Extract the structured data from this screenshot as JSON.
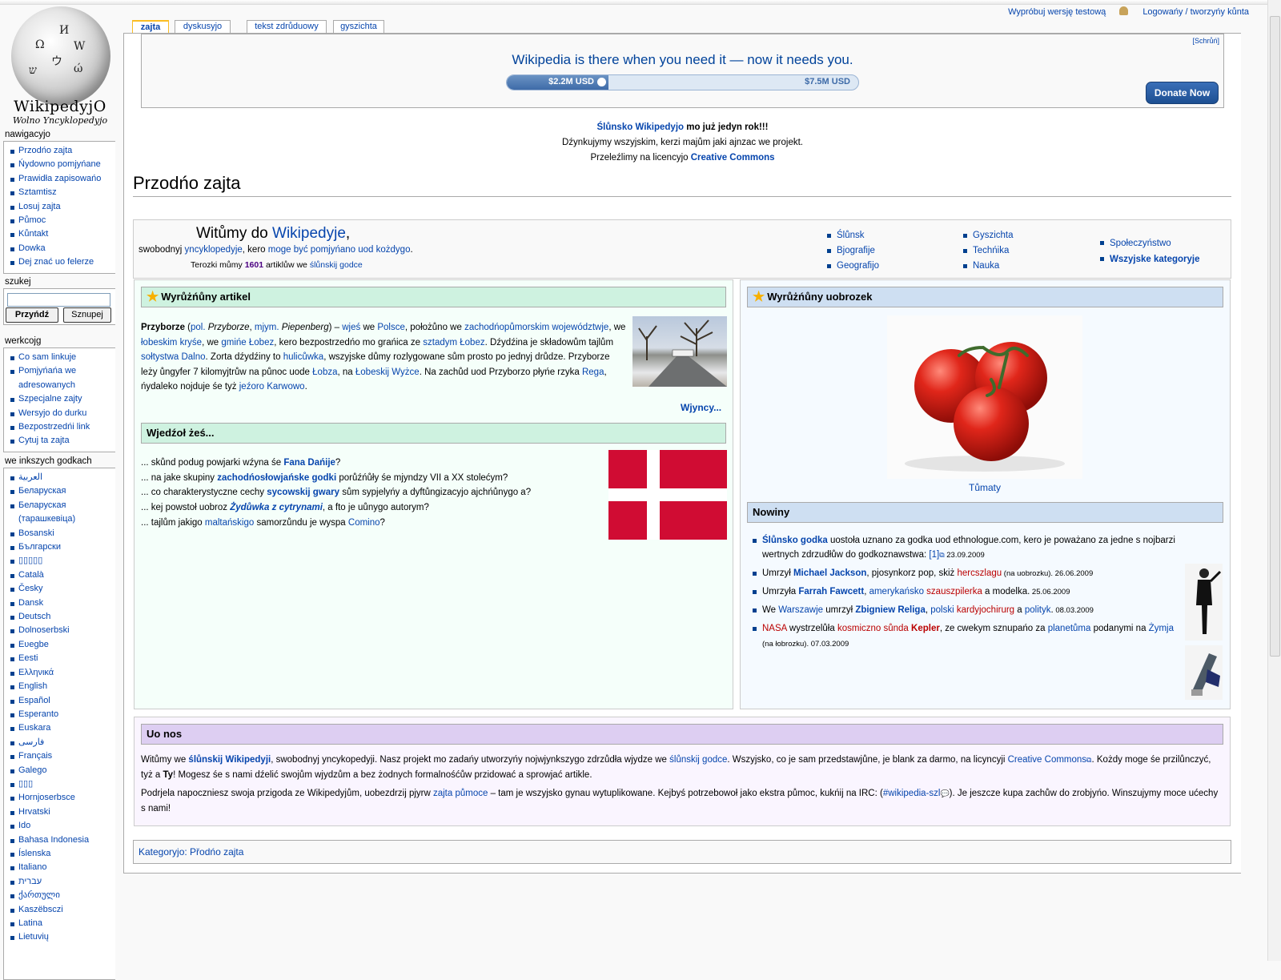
{
  "personal": {
    "beta": "Wypróbuj wersję testową",
    "login": "Logowańy / tworzyńy kůnta"
  },
  "logo": {
    "wordmark": "WikipedyjO",
    "tagline": "Wolno Yncyklopedyjo"
  },
  "tabs": [
    "zajta",
    "dyskusyjo",
    "tekst zdrůduowy",
    "gyszichta"
  ],
  "nav": {
    "title": "nawigacyjo",
    "items": [
      "Przodńo zajta",
      "Ńydowno pomjyńane",
      "Prawidła zapisowańo",
      "Sztamtisz",
      "Losuj zajta",
      "Půmoc",
      "Kůntakt",
      "Dowka",
      "Dej znać uo felerze"
    ]
  },
  "search": {
    "title": "szukej",
    "go": "Przyńdź",
    "find": "Sznupej"
  },
  "tools": {
    "title": "werkcojg",
    "items": [
      "Co sam linkuje",
      "Pomjyńańa we adresowanych",
      "Szpecjalne zajty",
      "Wersyjo do durku",
      "Bezpostrzedńi link",
      "Cytuj ta zajta"
    ]
  },
  "langs": {
    "title": "we inkszych godkach",
    "items": [
      "العربية",
      "Беларуская",
      "Беларуская (тарашкевіца)",
      "Bosanski",
      "Български",
      "▯▯▯▯▯",
      "Català",
      "Česky",
      "Dansk",
      "Deutsch",
      "Dolnoserbski",
      "Eʋegbe",
      "Eesti",
      "Ελληνικά",
      "English",
      "Español",
      "Esperanto",
      "Euskara",
      "فارسی",
      "Français",
      "Galego",
      "▯▯▯",
      "Hornjoserbsce",
      "Hrvatski",
      "Ido",
      "Bahasa Indonesia",
      "Íslenska",
      "Italiano",
      "עברית",
      "ქართული",
      "Kaszëbsczi",
      "Latina",
      "Lietuvių"
    ]
  },
  "banner": {
    "close": "[Schrůń]",
    "headline": "Wikipedia is there when you need it — now it needs you.",
    "raised": "$2.2M USD",
    "goal": "$7.5M USD",
    "progress": 0.29,
    "donate": "Donate Now"
  },
  "sitenotice": {
    "l1_link": "Ślůnsko Wikipedyjo",
    "l1_rest": " mo już jedyn rok!!!",
    "l2": "Dźynkujymy wszyjskim, kerzi majům jaki ajnzac we projekt.",
    "l3_pre": "Przeleźlimy na licencyjo ",
    "l3_link": "Creative Commons"
  },
  "heading": "Przodńo zajta",
  "welcome": {
    "pre": "Witůmy do ",
    "link": "Wikipedyje",
    "post": ",",
    "l2a": "swobodnyj ",
    "l2b": "yncyklopedyje",
    "l2c": ", kero ",
    "l2d": "moge być pomjyńano uod kożdygo",
    "l3a": "Terozki můmy ",
    "count": "1601",
    "l3b": " artiklůw we ",
    "l3c": "ślůnskij godce",
    "portals1": [
      "Ślůnsk",
      "Bjografije",
      "Geografijo"
    ],
    "portals2": [
      "Gyszichta",
      "Techńika",
      "Nauka"
    ],
    "portals3": [
      "Społeczyństwo",
      "Wszyjske kategoryje"
    ]
  },
  "article": {
    "title": "Wyrůżńůny artikel",
    "more": "Wjyncy...",
    "t": {
      "a": "Przyborze",
      "b": " (",
      "c": "pol.",
      "d": " ",
      "e": "Przyborze",
      "f": ", ",
      "g": "mjym.",
      "h": " ",
      "i": "Piepenberg",
      "j": ") – ",
      "k": "wjeś",
      "l": " we ",
      "m": "Polsce",
      "n": ", położůno we ",
      "o": "zachodńopůmorskim województwje",
      "p": ", we ",
      "q": "łobeskim kryśe",
      "r": ", we ",
      "s": "gmińe Łobez",
      "t": ", kero bezpostrzedńo mo grańica ze ",
      "u": "sztadym Łobez",
      "v": ". Dźydźina je składowům tajlům ",
      "w": "sołtystwa Dalno",
      "x": ". Zorta dźydźiny to ",
      "y": "hulicůwka",
      "z": ", wszyjske důmy rozlygowane sům prosto po jednyj drůdze. Przyborze leży ůngyfer 7 kilomyjtrůw na půnoc uode ",
      "aa": "Łobza",
      "ab": ", na ",
      "ac": "Łobeskij Wyżce",
      "ad": ". Na zachůd uod Przyborzo płyńe rzyka ",
      "ae": "Rega",
      "af": ", ńydaleko nojduje śe tyż ",
      "ag": "jeźoro Karwowo",
      "ah": "."
    }
  },
  "dyk": {
    "title": "Wjedźoł żeś...",
    "r1a": "... skůnd podug powjarki wźyna śe ",
    "r1b": "Fana Dańije",
    "r1c": "?",
    "r2a": "... na jake skupiny ",
    "r2b": "zachodńosłowjańske godki",
    "r2c": " porůźńůły śe mjyndzy VII a XX stolećym?",
    "r3a": "... co charakterystyczne cechy ",
    "r3b": "sycowskij gwary",
    "r3c": " sům sypjelyńy a dyftůngizacyjo ajchńůnygo a?",
    "r4a": "... kej powstoł uobroz ",
    "r4b": "Żydůwka z cytrynami",
    "r4c": ", a fto je uůnygo autorym?",
    "r5a": "... tajlům jakigo ",
    "r5b": "maltańskigo",
    "r5c": " samorzůndu je wyspa ",
    "r5d": "Comino",
    "r5e": "?"
  },
  "picture": {
    "title": "Wyrůżńůny uobrozek",
    "caption": "Tůmaty"
  },
  "news": {
    "title": "Nowiny",
    "n1a": "Ślůnsko godka",
    "n1b": " uostoła uznano za godka uod ethnologue.com, kero je poważano za jedne s nojbarzi wertnych zdrzudłůw do godkoznawstwa: ",
    "n1c": "[1]",
    "n1d": " 23.09.2009",
    "n2a": "Umrzył ",
    "n2b": "Michael Jackson",
    "n2c": ", pjosynkorz pop, skiż ",
    "n2d": "hercszlagu",
    "n2e": " (na uobrozku).",
    "n2f": " 26.06.2009",
    "n3a": "Umrzyła ",
    "n3b": "Farrah Fawcett",
    "n3c": ", ",
    "n3d": "amerykańsko",
    "n3e": " ",
    "n3f": "szauszpilerka",
    "n3g": " a modelka.",
    "n3h": " 25.06.2009",
    "n4a": "We ",
    "n4b": "Warszawje",
    "n4c": " umrzył ",
    "n4d": "Zbigniew Religa",
    "n4e": ", ",
    "n4f": "polski",
    "n4g": " ",
    "n4h": "kardyjochirurg",
    "n4i": " a ",
    "n4j": "polityk",
    "n4k": ".",
    "n4l": " 08.03.2009",
    "n5a": "NASA",
    "n5b": " wystrzelůła ",
    "n5c": "kosmiczno sůnda",
    "n5d": " ",
    "n5e": "Kepler",
    "n5f": ", ze cwekym sznupańo za ",
    "n5g": "planetůma",
    "n5h": " podanymi na ",
    "n5i": "Żymja",
    "n5j": " (na łobrozku).",
    "n5k": " 07.03.2009"
  },
  "about": {
    "title": "Uo nos",
    "p1a": "Witůmy we ",
    "p1b": "ślůnskij Wikipedyji",
    "p1c": ", swobodnyj yncykopedyji. Nasz projekt mo zadańy utworzyńy nojwjynkszygo zdrzůdła wjydze we ",
    "p1d": "ślůnskij godce",
    "p1e": ". Wszyjsko, co je sam przedstawjůne, je blank za darmo, na licyncyji ",
    "p1f": "Creative Commons",
    "p1g": ". Kożdy moge śe przilůnczyć, tyż a ",
    "p1h": "Ty",
    "p1i": "! Mogesz śe s nami dźelić swojům wjydzům a bez żodnych formalnośćůw przidować a sprowjać artikle.",
    "p2a": "Podrjela napoczniesz swoja przigoda ze Wikipedyjům, uobezdrzij pjyrw ",
    "p2b": "zajta půmoce",
    "p2c": " – tam je wszyjsko gynau wytuplikowane. Kejbyś potrzebowoł jako ekstra půmoc, kukńij na IRC: (",
    "p2d": "#wikipedia-szl",
    "p2e": "). Je jeszcze kupa zachůw do zrobjyńo. Winszujymy moce ućechy s nami!"
  },
  "catlinks": {
    "label": "Kategoryjo:",
    "link": "Přodńo zajta"
  },
  "colors": {
    "link": "#0645ad",
    "redlink": "#ba0000",
    "article_bg": "#f5fffa",
    "article_head": "#cef2e0",
    "picture_bg": "#f5faff",
    "picture_head": "#cedff2",
    "about_bg": "#faf5ff",
    "about_head": "#ddcef2",
    "tab_selected": "#fabd23"
  }
}
